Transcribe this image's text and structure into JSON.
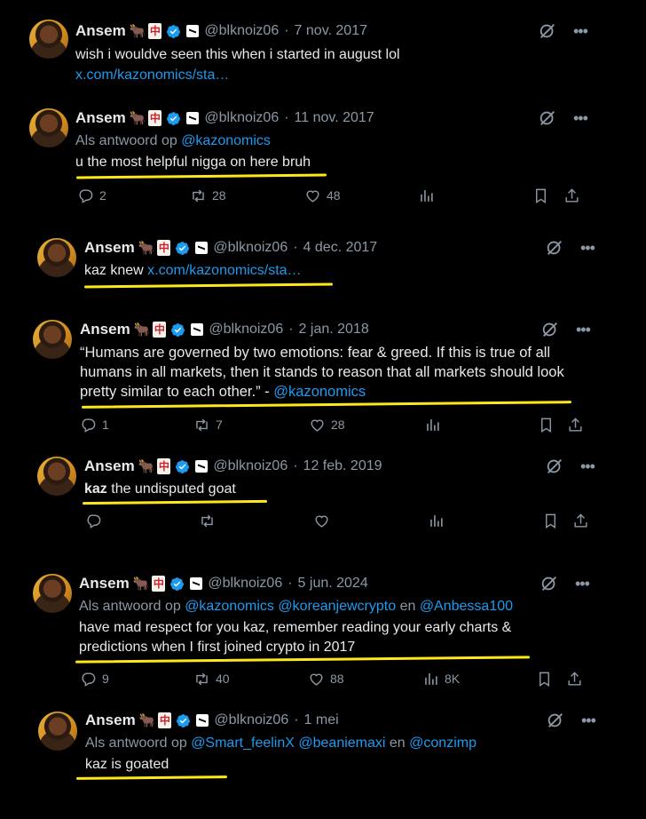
{
  "display_name": "Ansem",
  "handle": "@blknoiz06",
  "badges": {
    "ox": "🐂",
    "mahjong": "中"
  },
  "reply_prefix": "Als antwoord op",
  "reply_conj": "en",
  "tweets": [
    {
      "date": "7 nov. 2017",
      "text": "wish i wouldve seen this when i started in august lol",
      "link": "x.com/kazonomics/sta…"
    },
    {
      "date": "11 nov. 2017",
      "reply_to": "@kazonomics",
      "text": "u the most helpful nigga on here bruh",
      "replies": "2",
      "reposts": "28",
      "likes": "48"
    },
    {
      "date": "4 dec. 2017",
      "text": "kaz knew",
      "link": "x.com/kazonomics/sta…"
    },
    {
      "date": "2 jan. 2018",
      "text_l1": "“Humans are governed by two emotions: fear & greed. If this is true of all",
      "text_l2": "humans in all markets, then it stands to reason that all markets should look",
      "text_l3": "pretty similar to each other.” -",
      "mention": "@kazonomics",
      "replies": "1",
      "reposts": "7",
      "likes": "28"
    },
    {
      "date": "12 feb. 2019",
      "text_bold": "kaz",
      "text": " the undisputed goat"
    },
    {
      "date": "5 jun. 2024",
      "reply_1": "@kazonomics",
      "reply_2": "@koreanjewcrypto",
      "reply_3": "@Anbessa100",
      "text_l1": "have mad respect for you kaz, remember reading your early charts &",
      "text_l2": "predictions when I first joined crypto in 2017",
      "replies": "9",
      "reposts": "40",
      "likes": "88",
      "views": "8K"
    },
    {
      "date": "1 mei",
      "reply_1": "@Smart_feelinX",
      "reply_2": "@beaniemaxi",
      "reply_3": "@conzimp",
      "text": "kaz is goated"
    }
  ]
}
